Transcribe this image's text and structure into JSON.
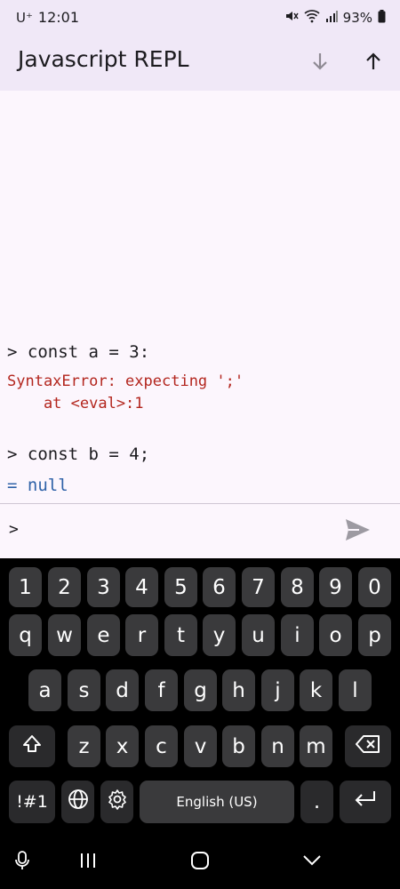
{
  "status_bar": {
    "carrier": "U⁺",
    "time": "12:01",
    "battery": "93%"
  },
  "app_bar": {
    "title": "Javascript REPL",
    "icons": [
      "arrow-down-icon",
      "arrow-up-icon"
    ]
  },
  "console": {
    "entries": [
      {
        "kind": "input",
        "text": "> const a = 3:"
      },
      {
        "kind": "error",
        "text": "SyntaxError: expecting ';'"
      },
      {
        "kind": "error",
        "text": "    at <eval>:1"
      },
      {
        "kind": "input",
        "text": "> const b = 4;"
      },
      {
        "kind": "result",
        "text": "= null"
      }
    ]
  },
  "input": {
    "prompt": ">",
    "value": ""
  },
  "keyboard": {
    "row1": [
      "1",
      "2",
      "3",
      "4",
      "5",
      "6",
      "7",
      "8",
      "9",
      "0"
    ],
    "row2": [
      "q",
      "w",
      "e",
      "r",
      "t",
      "y",
      "u",
      "i",
      "o",
      "p"
    ],
    "row3": [
      "a",
      "s",
      "d",
      "f",
      "g",
      "h",
      "j",
      "k",
      "l"
    ],
    "row4": [
      "z",
      "x",
      "c",
      "v",
      "b",
      "n",
      "m"
    ],
    "symbols_key": "!#1",
    "space_label": "English (US)",
    "period": "."
  },
  "colors": {
    "app_bg": "#fcf6fd",
    "bar_bg": "#f0e8f7",
    "error": "#b3261e",
    "result": "#2f62a8",
    "key": "#3a3a3c"
  }
}
